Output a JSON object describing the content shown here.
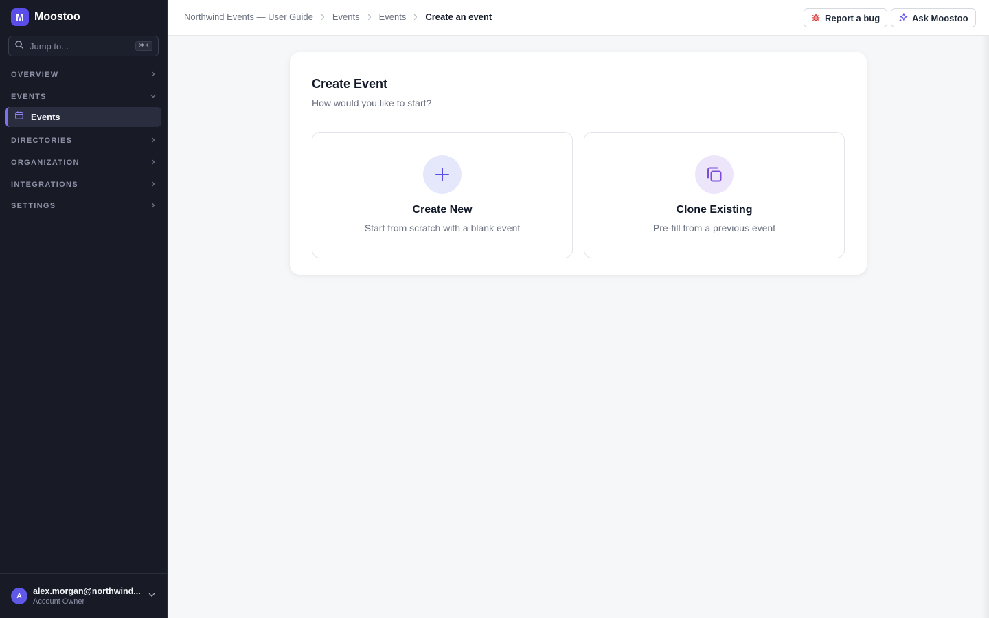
{
  "app": {
    "logo_letter": "M",
    "name": "Moostoo"
  },
  "search": {
    "placeholder": "Jump to...",
    "shortcut": "⌘K"
  },
  "sidebar": {
    "sections": [
      {
        "label": "OVERVIEW",
        "expanded": false
      },
      {
        "label": "EVENTS",
        "expanded": true
      },
      {
        "label": "DIRECTORIES",
        "expanded": false
      },
      {
        "label": "ORGANIZATION",
        "expanded": false
      },
      {
        "label": "INTEGRATIONS",
        "expanded": false
      },
      {
        "label": "SETTINGS",
        "expanded": false
      }
    ],
    "active_item": {
      "label": "Events",
      "icon": "calendar-icon"
    }
  },
  "user": {
    "initial": "A",
    "email": "alex.morgan@northwind...",
    "role": "Account Owner"
  },
  "breadcrumb": {
    "items": [
      "Northwind Events — User Guide",
      "Events",
      "Events"
    ],
    "current": "Create an event"
  },
  "header_actions": {
    "report_bug": "Report a bug",
    "ask": "Ask Moostoo"
  },
  "main": {
    "title": "Create Event",
    "subtitle": "How would you like to start?",
    "options": [
      {
        "title": "Create New",
        "description": "Start from scratch with a blank event",
        "icon": "plus-icon"
      },
      {
        "title": "Clone Existing",
        "description": "Pre-fill from a previous event",
        "icon": "copy-icon"
      }
    ]
  },
  "colors": {
    "sidebar_bg": "#181a26",
    "accent": "#5b4ee8",
    "bug_red": "#dc3b3b"
  }
}
